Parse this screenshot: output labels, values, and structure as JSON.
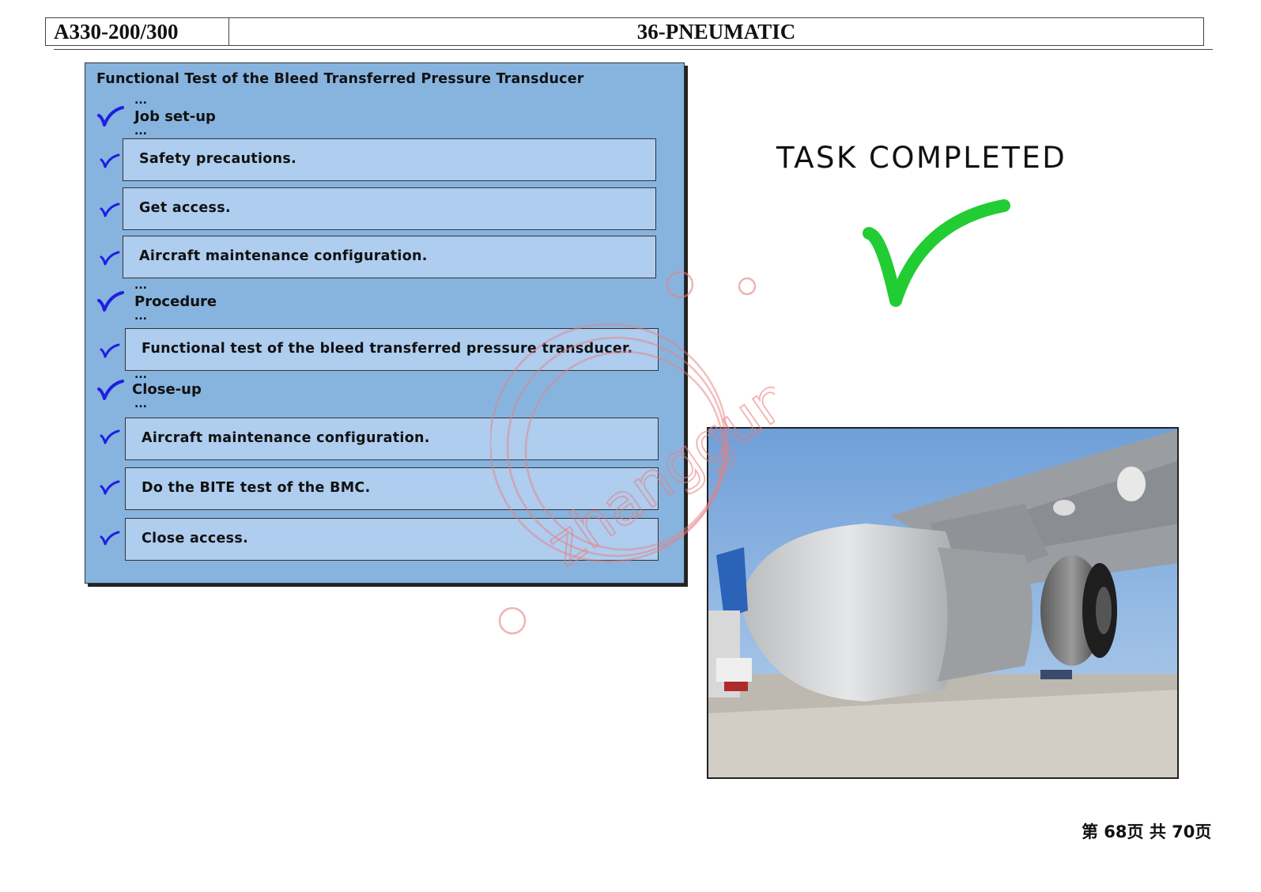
{
  "header": {
    "model": "A330-200/300",
    "chapter": "36-PNEUMATIC"
  },
  "panel": {
    "title": "Functional Test of the Bleed Transferred Pressure Transducer",
    "ellipsis": "...",
    "sections": [
      {
        "label": "Job set-up",
        "steps": [
          "Safety precautions.",
          "Get access.",
          "Aircraft maintenance configuration."
        ]
      },
      {
        "label": "Procedure",
        "steps": [
          "Functional test of the bleed transferred pressure transducer."
        ]
      },
      {
        "label": "Close-up",
        "steps": [
          "Aircraft maintenance configuration.",
          "Do the BITE test of the BMC.",
          "Close access."
        ]
      }
    ],
    "tick_color": "#1f1fe0"
  },
  "status": {
    "text": "TASK COMPLETED",
    "check_color": "#22cc33"
  },
  "watermark": {
    "text": "zhanggun",
    "color": "#e88080"
  },
  "footer": {
    "page": "第 68页  共 70页"
  }
}
